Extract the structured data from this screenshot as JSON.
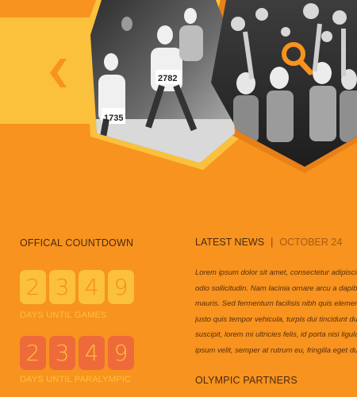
{
  "hero": {
    "prev_icon": "chevron-left-icon",
    "search_icon": "search-icon",
    "runners_bibs": [
      "2782",
      "1735"
    ],
    "colors": {
      "yellow": "#fbc13c",
      "orange": "#f7931e",
      "dark_orange": "#e8801a"
    }
  },
  "countdown": {
    "title": "OFFICAL COUNTDOWN",
    "games_digits": [
      "2",
      "3",
      "4",
      "9"
    ],
    "games_label": "DAYS UNTIL GAMES",
    "paralympic_digits": [
      "2",
      "3",
      "4",
      "9"
    ],
    "paralympic_label": "DAYS UNTIL PARALYMPIC"
  },
  "news": {
    "title": "LATEST NEWS",
    "separator": "|",
    "date": "OCTOBER 24",
    "lines": [
      "Lorem ipsum dolor sit amet, consectetur adipiscing",
      "odio sollicitudin. Nam lacinia ornare arcu a dapibus",
      "mauris. Sed fermentum facilisis nibh quis elementum.",
      "justo quis tempor vehicula, turpis dui tincidunt dui,",
      "suscipit, lorem mi ultricies felis, id porta nisi ligula",
      "ipsum velit, semper at rutrum eu, fringilla eget dui."
    ]
  },
  "partners": {
    "title": "OLYMPIC PARTNERS"
  }
}
